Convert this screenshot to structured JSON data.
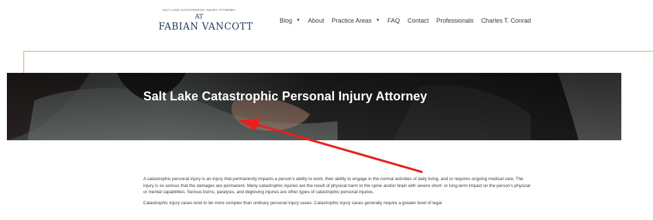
{
  "header": {
    "logo": {
      "tagline": "SALT LAKE CATASTROPHIC INJURY ATTORNEY",
      "at": "AT",
      "firm": "FABIAN VANCOTT"
    },
    "nav": [
      {
        "label": "Blog",
        "dropdown": true
      },
      {
        "label": "About",
        "dropdown": false
      },
      {
        "label": "Practice Areas",
        "dropdown": true
      },
      {
        "label": "FAQ",
        "dropdown": false
      },
      {
        "label": "Contact",
        "dropdown": false
      },
      {
        "label": "Professionals",
        "dropdown": false
      },
      {
        "label": "Charles T. Conrad",
        "dropdown": false
      }
    ]
  },
  "hero": {
    "title": "Salt Lake Catastrophic Personal Injury Attorney"
  },
  "content": {
    "paragraphs": [
      "A catastrophic personal injury is an injury that permanently impacts a person's ability to work, their ability to engage in the normal activities of daily living, and or requires ongoing medical care. The injury is so serious that the damages are permanent. Many catastrophic injuries are the result of physical harm to the spine and/or brain with severe short- or long-term impact on the person's physical or mental capabilities. Serious burns, paralysis, and degloving injuries are other types of catastrophic personal injuries.",
      "Catastrophic injury cases tend to be more complex than ordinary personal injury cases. Catastrophic injury cases generally require a greater level of legal"
    ]
  },
  "colors": {
    "accent_line": "#e0a36b",
    "logo_navy": "#1f3a5a",
    "annotation_arrow": "#e8201c"
  }
}
